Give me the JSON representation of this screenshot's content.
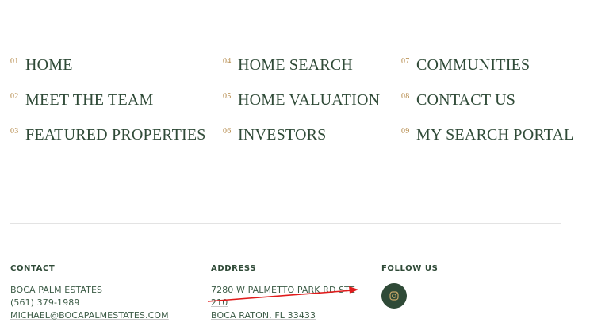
{
  "nav": {
    "items": [
      {
        "num": "01",
        "label": "HOME"
      },
      {
        "num": "02",
        "label": "MEET THE TEAM"
      },
      {
        "num": "03",
        "label": "FEATURED PROPERTIES"
      },
      {
        "num": "04",
        "label": "HOME SEARCH"
      },
      {
        "num": "05",
        "label": "HOME VALUATION"
      },
      {
        "num": "06",
        "label": "INVESTORS"
      },
      {
        "num": "07",
        "label": "COMMUNITIES"
      },
      {
        "num": "08",
        "label": "CONTACT US"
      },
      {
        "num": "09",
        "label": "MY SEARCH PORTAL"
      }
    ]
  },
  "footer": {
    "contact": {
      "heading": "CONTACT",
      "company": "BOCA PALM ESTATES",
      "phone": "(561) 379-1989",
      "email": "MICHAEL@BOCAPALMESTATES.COM"
    },
    "address": {
      "heading": "ADDRESS",
      "line1": "7280 W PALMETTO PARK RD STE",
      "line2": "210",
      "line3": "BOCA RATON, FL 33433"
    },
    "follow": {
      "heading": "FOLLOW US",
      "icon": "instagram-icon"
    }
  },
  "colors": {
    "brand_green": "#2f4a37",
    "number_gold": "#b58a4a",
    "annotation_red": "#e01b1b"
  }
}
